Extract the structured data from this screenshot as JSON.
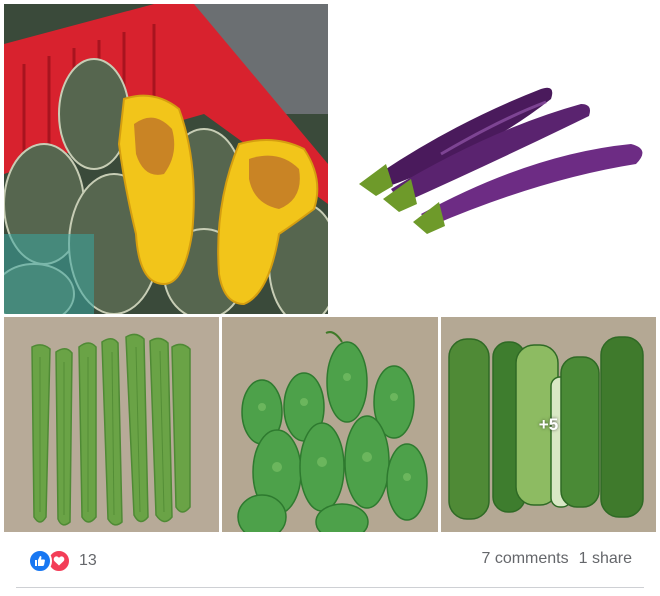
{
  "photos": [
    {
      "subject": "pumpkin"
    },
    {
      "subject": "eggplant"
    },
    {
      "subject": "okra"
    },
    {
      "subject": "bitter melon"
    },
    {
      "subject": "cucumber",
      "more_label": "+5"
    }
  ],
  "reactions": {
    "icons": [
      "like-icon",
      "love-icon"
    ],
    "count": "13",
    "comments": "7 comments",
    "shares": "1 share"
  },
  "colors": {
    "like": "#1877f2",
    "love": "#f33e58",
    "text_secondary": "#65676b",
    "divider": "#ced0d4"
  }
}
